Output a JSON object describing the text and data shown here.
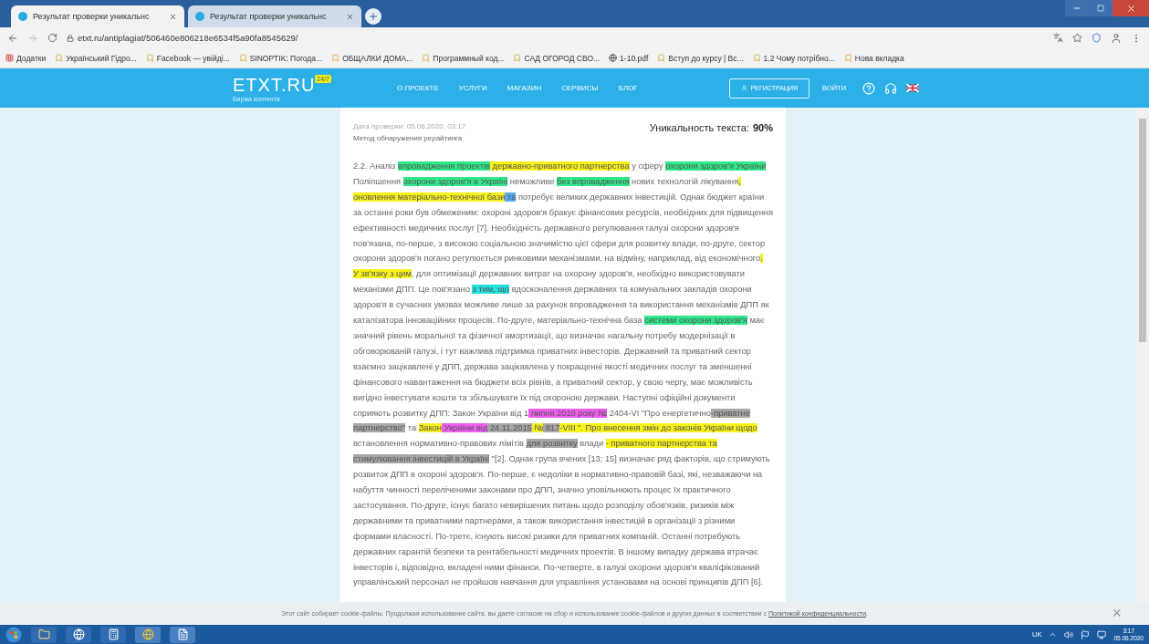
{
  "browser": {
    "tabs": [
      {
        "title": "Результат проверки уникальнс",
        "selected": true
      },
      {
        "title": "Результат проверки уникальнс",
        "selected": false
      }
    ],
    "address": "etxt.ru/antiplagiat/506460e806218e6534f5a90fa8545629/",
    "bookmarks": [
      "Додатки",
      "Український Гідро...",
      "Facebook — увійді...",
      "SINOPTIK: Погода...",
      "ОБЩАЛКИ ДОМА...",
      "Программный код...",
      "САД ОГОРОД СВО...",
      "1-10.pdf",
      "Вступ до курсу | Вс...",
      "1.2 Чому потрібно...",
      "Нова вкладка"
    ]
  },
  "site_header": {
    "logo": "ETXT.RU",
    "logo_badge": "24/7",
    "logo_subtitle": "Биржа контента",
    "nav": [
      "О ПРОЕКТЕ",
      "УСЛУГИ",
      "МАГАЗИН",
      "СЕРВИСЫ",
      "БЛОГ"
    ],
    "register": "РЕГИСТРАЦИЯ",
    "login": "ВОЙТИ"
  },
  "report": {
    "check_date": "Дата проверки: 05.06.2020, 03:17.",
    "method": "Метод обнаружения рерайтинга",
    "uniqueness_label": "Уникальность текста:",
    "uniqueness_value": "90%",
    "lines": [
      [
        {
          "t": "2.2. Аналіз "
        },
        {
          "t": "впровадження проектів",
          "color": "#2ee88a"
        },
        {
          "t": " державно-приватного партнерства",
          "color": "#f7f21a"
        },
        {
          "t": " у сферу "
        },
        {
          "t": "охорони здоров'я України",
          "color": "#2ee88a"
        }
      ],
      [
        {
          "t": "Поліпшення "
        },
        {
          "t": "охорони здоров'я в Україні",
          "color": "#2ee88a"
        },
        {
          "t": " неможливе "
        },
        {
          "t": "без впровадження",
          "color": "#2ee88a"
        },
        {
          "t": " нових технологій лікування"
        },
        {
          "t": ",",
          "color": "#f7f21a"
        }
      ],
      [
        {
          "t": "оновлення матеріально-технічної бази",
          "color": "#f7f21a"
        },
        {
          "t": " та",
          "color": "#59a8f0"
        },
        {
          "t": " потребує великих державних інвестицій. Однак бюджет країни"
        }
      ],
      [
        {
          "t": "за останні роки був обмеженим: охороні здоров'я бракує фінансових ресурсів, необхідних для підвищення"
        }
      ],
      [
        {
          "t": "ефективності медичних послуг [7]. Необхідність державного регулювання галузі охорони здоров'я"
        }
      ],
      [
        {
          "t": "пов'язана, по-перше, з високою соціальною значимістю цієї сфери для розвитку влади, по-друге, сектор"
        }
      ],
      [
        {
          "t": "охорони здоров'я погано регулюється ринковими механізмами, на відміну, наприклад, від економічного"
        },
        {
          "t": ".",
          "color": "#f7f21a"
        }
      ],
      [
        {
          "t": "У зв'язку з цим",
          "color": "#f7f21a"
        },
        {
          "t": ", для оптимізації державних витрат на охорону здоров'я, необхідно використовувати"
        }
      ],
      [
        {
          "t": "механізми ДПП. Це пов'язано "
        },
        {
          "t": "з тим, що",
          "color": "#24e0dc"
        },
        {
          "t": " вдосконалення державних та комунальних закладів охорони"
        }
      ],
      [
        {
          "t": "здоров'я в сучасних умовах можливе лише за рахунок впровадження та використання механізмів ДПП як"
        }
      ],
      [
        {
          "t": "каталізатора інноваційних процесів. По-друге, матеріально-технічна база "
        },
        {
          "t": "системи охорони здоров'я",
          "color": "#2ee88a"
        },
        {
          "t": " має"
        }
      ],
      [
        {
          "t": "значний рівень моральної та фізичної амортизації, що визначає нагальну потребу модернізації в"
        }
      ],
      [
        {
          "t": "обговорюваній галузі, і тут важлива підтримка приватних інвесторів. Державний та приватний сектор"
        }
      ],
      [
        {
          "t": "взаємно зацікавлені у ДПП, держава зацікавлена у покращенні якості медичних послуг та зменшенні"
        }
      ],
      [
        {
          "t": "фінансового навантаження на бюджети всіх рівнів, а приватний сектор, у свою чергу, має можливість"
        }
      ],
      [
        {
          "t": "вигідно інвестувати кошти та збільшувати їх під охороною держави. Наступні офіційні документи"
        }
      ],
      [
        {
          "t": "сприяють розвитку ДПП: Закон України від 1"
        },
        {
          "t": " липня 2010 року №",
          "color": "#f05cf0"
        },
        {
          "t": " 2404-VI \"Про енергетично"
        },
        {
          "t": "-приватне",
          "color": "#a8a8a8"
        }
      ],
      [
        {
          "t": "партнерство\"",
          "color": "#a8a8a8"
        },
        {
          "t": " та "
        },
        {
          "t": "Закон",
          "color": "#f7f21a"
        },
        {
          "t": " України від",
          "color": "#f05cf0"
        },
        {
          "t": " 24.11.2015",
          "color": "#a8a8a8"
        },
        {
          "t": " №",
          "color": "#f7f21a"
        },
        {
          "t": " 817",
          "color": "#a8a8a8"
        },
        {
          "t": "-VIII \". Про внесення змін до законів України щодо",
          "color": "#f7f21a"
        }
      ],
      [
        {
          "t": "встановлення нормативно-правових лімітів "
        },
        {
          "t": "для розвитку",
          "color": "#a8a8a8"
        },
        {
          "t": " влади "
        },
        {
          "t": "- приватного партнерства та",
          "color": "#f7f21a"
        }
      ],
      [
        {
          "t": "стимулювання інвестицій в Україні",
          "color": "#a8a8a8"
        },
        {
          "t": " \"[2]. Однак група вчених [13; 15] визначає ряд факторів, що стримують"
        }
      ],
      [
        {
          "t": "розвиток ДПП в охороні здоров'я. По-перше, є недоліки в нормативно-правовій базі, які, незважаючи на"
        }
      ],
      [
        {
          "t": "набуття чинності переліченими законами про ДПП, значно уповільнюють процес їх практичного"
        }
      ],
      [
        {
          "t": "застосування. По-друге, існує багато невирішених питань щодо розподілу обов'язків, ризиків між"
        }
      ],
      [
        {
          "t": "державними та приватними партнерами, а також використання інвестицій в організації з різними"
        }
      ],
      [
        {
          "t": "формами власності. По-третє, існують високі ризики для приватних компаній. Останні потребують"
        }
      ],
      [
        {
          "t": "державних гарантій безпеки та рентабельності медичних проектів. В іншому випадку держава втрачає"
        }
      ],
      [
        {
          "t": "інвесторів і, відповідно, вкладені ними фінанси. По-четверте, в галузі охорони здоров'я кваліфікований"
        }
      ],
      [
        {
          "t": "управлінський персонал не пройшов навчання для управління установами на основі принципів ДПП [6]."
        }
      ]
    ]
  },
  "cookie_bar": {
    "text": "Этот сайт собирает cookie-файлы. Продолжая использование сайта, вы даете согласие на сбор и использование cookie-файлов и других данных в соответствии с",
    "link": "Политикой конфиденциальности",
    "end": ".",
    "close": "×"
  },
  "taskbar": {
    "language": "UK",
    "time": "3:17",
    "date": "05.06.2020"
  }
}
